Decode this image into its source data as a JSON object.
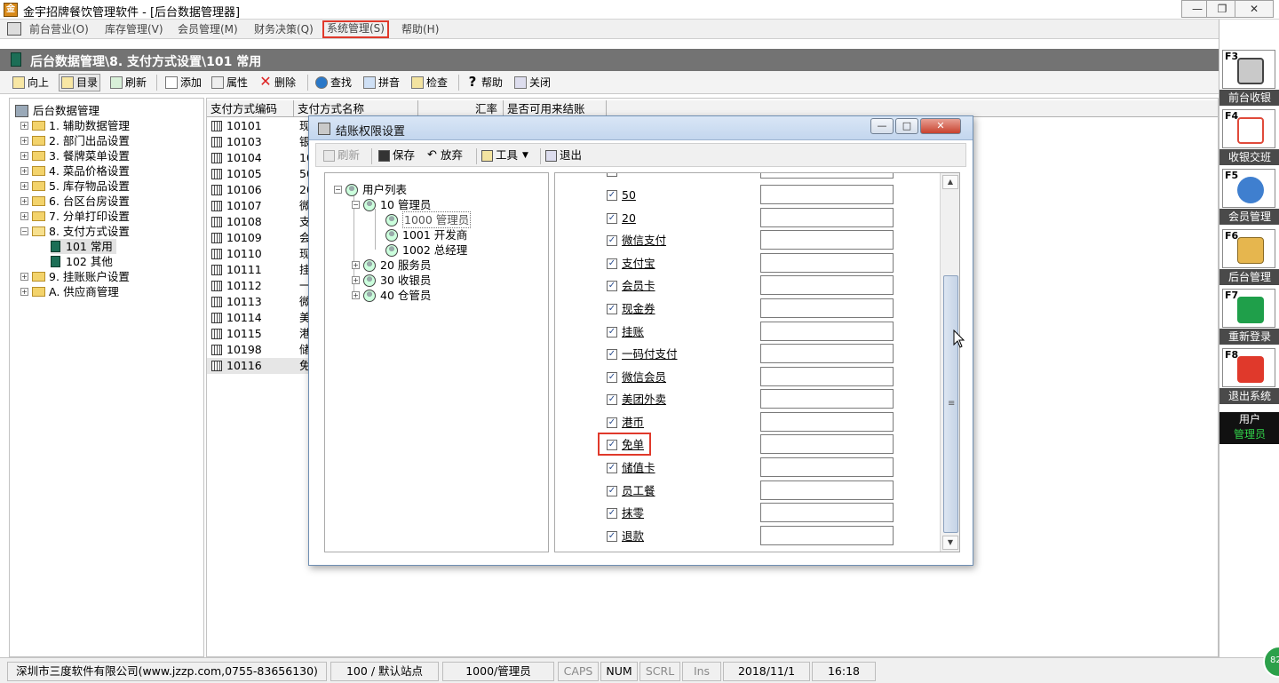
{
  "window": {
    "title": "金宇招牌餐饮管理软件 - [后台数据管理器]",
    "app_icon_glyph": "金",
    "buttons": {
      "minimize": "—",
      "restore": "❐",
      "close": "✕"
    }
  },
  "menu": {
    "items": [
      "前台营业(O)",
      "库存管理(V)",
      "会员管理(M)",
      "财务决策(Q)",
      "系统管理(S)",
      "帮助(H)"
    ],
    "mdi_buttons": [
      "_",
      "❐",
      "✕"
    ]
  },
  "pathbar": {
    "text": "后台数据管理\\8. 支付方式设置\\101 常用"
  },
  "toolbar": {
    "up": "向上",
    "catalog": "目录",
    "refresh": "刷新",
    "add": "添加",
    "properties": "属性",
    "delete": "删除",
    "find": "查找",
    "pinyin": "拼音",
    "check": "检查",
    "help": "帮助",
    "close": "关闭"
  },
  "tree": {
    "root": "后台数据管理",
    "items": [
      "1. 辅助数据管理",
      "2. 部门出品设置",
      "3. 餐牌菜单设置",
      "4. 菜品价格设置",
      "5. 库存物品设置",
      "6. 台区台房设置",
      "7. 分单打印设置",
      "8. 支付方式设置",
      "9. 挂账账户设置",
      "A. 供应商管理"
    ],
    "children": [
      "101 常用",
      "102 其他"
    ]
  },
  "grid": {
    "headers": [
      "支付方式编码",
      "支付方式名称",
      "汇率",
      "是否可用来结账"
    ],
    "rows": [
      {
        "code": "10101",
        "name": "现"
      },
      {
        "code": "10103",
        "name": "银"
      },
      {
        "code": "10104",
        "name": "10"
      },
      {
        "code": "10105",
        "name": "50"
      },
      {
        "code": "10106",
        "name": "20"
      },
      {
        "code": "10107",
        "name": "微"
      },
      {
        "code": "10108",
        "name": "支"
      },
      {
        "code": "10109",
        "name": "会"
      },
      {
        "code": "10110",
        "name": "现"
      },
      {
        "code": "10111",
        "name": "挂"
      },
      {
        "code": "10112",
        "name": "一"
      },
      {
        "code": "10113",
        "name": "微"
      },
      {
        "code": "10114",
        "name": "美"
      },
      {
        "code": "10115",
        "name": "港"
      },
      {
        "code": "10198",
        "name": "储"
      },
      {
        "code": "10116",
        "name": "免"
      }
    ]
  },
  "rightbar": {
    "keys": [
      {
        "key": "F3",
        "label": "前台收银",
        "color": "#d8d8d8"
      },
      {
        "key": "F4",
        "label": "收银交班",
        "color": "#e04a3a"
      },
      {
        "key": "F5",
        "label": "会员管理",
        "color": "#3f7fcf"
      },
      {
        "key": "F6",
        "label": "后台管理",
        "color": "#d9a53a"
      },
      {
        "key": "F7",
        "label": "重新登录",
        "color": "#1f9f4a"
      },
      {
        "key": "F8",
        "label": "退出系统",
        "color": "#e0392b"
      }
    ],
    "user_label": "用户",
    "user_value": "管理员"
  },
  "status": {
    "company": "深圳市三度软件有限公司(www.jzzp.com,0755-83656130)",
    "station": "100 / 默认站点",
    "user": "1000/管理员",
    "caps": "CAPS",
    "num": "NUM",
    "scrl": "SCRL",
    "ins": "Ins",
    "date": "2018/11/1",
    "time": "16:18",
    "circle": "82"
  },
  "dialog": {
    "title": "结账权限设置",
    "toolbar": {
      "refresh": "刷新",
      "save": "保存",
      "discard": "放弃",
      "tools": "工具",
      "exit": "退出"
    },
    "tree": {
      "root": "用户列表",
      "group_manager": "10 管理员",
      "users": [
        "1000 管理员",
        "1001 开发商",
        "1002 总经理"
      ],
      "groups": [
        "20 服务员",
        "30 收银员",
        "40 仓管员"
      ]
    },
    "payments": [
      "50",
      "20",
      "微信支付",
      "支付宝",
      "会员卡",
      "现金券",
      "挂账",
      "一码付支付",
      "微信会员",
      "美团外卖",
      "港币",
      "免单",
      "储值卡",
      "员工餐",
      "抹零",
      "退款"
    ],
    "scroll_grip": "≡"
  }
}
